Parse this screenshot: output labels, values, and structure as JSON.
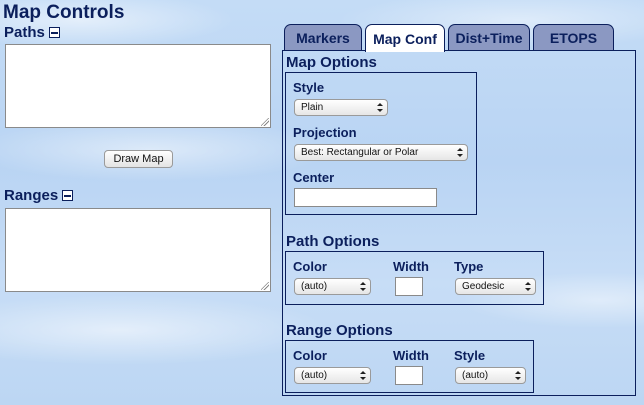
{
  "title": "Map Controls",
  "paths": {
    "label": "Paths",
    "value": ""
  },
  "ranges": {
    "label": "Ranges",
    "value": ""
  },
  "draw_button": "Draw Map",
  "tabs": [
    {
      "label": "Markers",
      "active": false
    },
    {
      "label": "Map Conf",
      "active": true
    },
    {
      "label": "Dist+Time",
      "active": false
    },
    {
      "label": "ETOPS",
      "active": false
    }
  ],
  "map_options": {
    "heading": "Map Options",
    "style_label": "Style",
    "style_value": "Plain",
    "projection_label": "Projection",
    "projection_value": "Best: Rectangular or Polar",
    "center_label": "Center",
    "center_value": ""
  },
  "path_options": {
    "heading": "Path Options",
    "color_label": "Color",
    "color_value": "(auto)",
    "width_label": "Width",
    "width_value": "",
    "type_label": "Type",
    "type_value": "Geodesic"
  },
  "range_options": {
    "heading": "Range Options",
    "color_label": "Color",
    "color_value": "(auto)",
    "width_label": "Width",
    "width_value": "",
    "style_label": "Style",
    "style_value": "(auto)"
  },
  "colors": {
    "heading": "#0b1f5c",
    "tab_inactive": "#8b98c2",
    "tab_active": "#ffffff"
  }
}
